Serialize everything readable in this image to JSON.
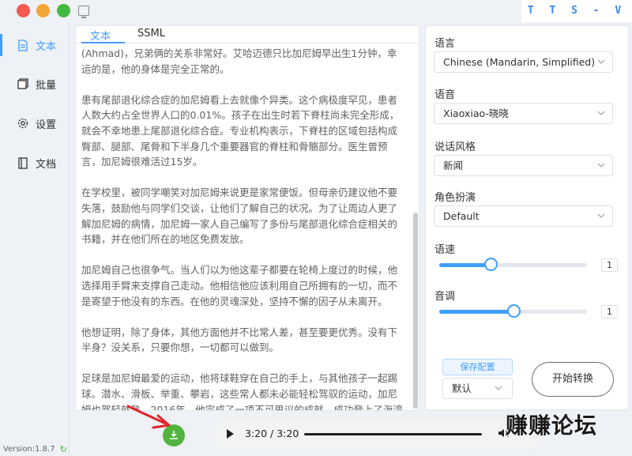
{
  "app": {
    "brand": "T T S - V U E"
  },
  "sidebar": {
    "items": [
      {
        "label": "文本",
        "icon": "document-icon",
        "active": true
      },
      {
        "label": "批量",
        "icon": "batch-icon"
      },
      {
        "label": "设置",
        "icon": "gear-icon"
      },
      {
        "label": "文档",
        "icon": "book-icon"
      }
    ],
    "version": "Version:1.8.7"
  },
  "editor": {
    "tabs": [
      {
        "label": "文本"
      },
      {
        "label": "SSML"
      }
    ],
    "paragraphs": [
      "(Ahmad)，兄弟俩的关系非常好。艾哈迈德只比加尼姆早出生1分钟，幸运的是，他的身体是完全正常的。",
      "患有尾部退化综合症的加尼姆看上去就像个异类。这个病极度罕见，患者人数大约占全世界人口的0.01%。孩子在出生时若下脊柱尚未完全形成，就会不幸地患上尾部退化综合症。专业机构表示，下脊柱的区域包括构成臀部、腿部、尾骨和下半身几个重要器官的脊柱和骨骼部分。医生曾预言，加尼姆很难活过15岁。",
      "在学校里，被同学嘲笑对加尼姆来说更是家常便饭。但母亲仍建议他不要失落，鼓励他与同学们交谈，让他们了解自己的状况。为了让周边人更了解加尼姆的病情，加尼姆一家人自己编写了多份与尾部退化综合症相关的书籍，并在他们所在的地区免费发放。",
      "加尼姆自己也很争气。当人们以为他这辈子都要在轮椅上度过的时候，他选择用手臂来支撑自己走动。他相信他应该利用自己所拥有的一切，而不是寄望于他没有的东西。在他的灵魂深处，坚持不懈的因子从未离开。",
      "他想证明，除了身体，其他方面他并不比常人差，甚至要更优秀。没有下半身？没关系，只要你想，一切都可以做到。",
      "足球是加尼姆最爱的运动，他将球鞋穿在自己的手上，与其他孩子一起踢球。潜水、滑板、举重、攀岩，这些常人都未必能轻松驾驭的运动，加尼姆也驾轻就熟。2016年，他完成了一项不可思议的成就，成功登上了海湾地区最高峰沙姆山的山顶。"
    ]
  },
  "settings": {
    "language": {
      "label": "语言",
      "value": "Chinese (Mandarin, Simplified)"
    },
    "voice": {
      "label": "语音",
      "value": "Xiaoxiao-晓晓"
    },
    "style": {
      "label": "说话风格",
      "value": "新闻"
    },
    "role": {
      "label": "角色扮演",
      "value": "Default"
    },
    "rate": {
      "label": "语速",
      "value": "1",
      "level": 0.35
    },
    "pitch": {
      "label": "音调",
      "value": "1",
      "level": 0.5
    },
    "save_config": "保存配置",
    "preset": "默认",
    "start": "开始转换"
  },
  "player": {
    "time": "3:20 / 3:20",
    "progress": 1.0
  },
  "watermark": "赚赚论坛",
  "colors": {
    "accent": "#409eff",
    "download": "#52b43e"
  }
}
